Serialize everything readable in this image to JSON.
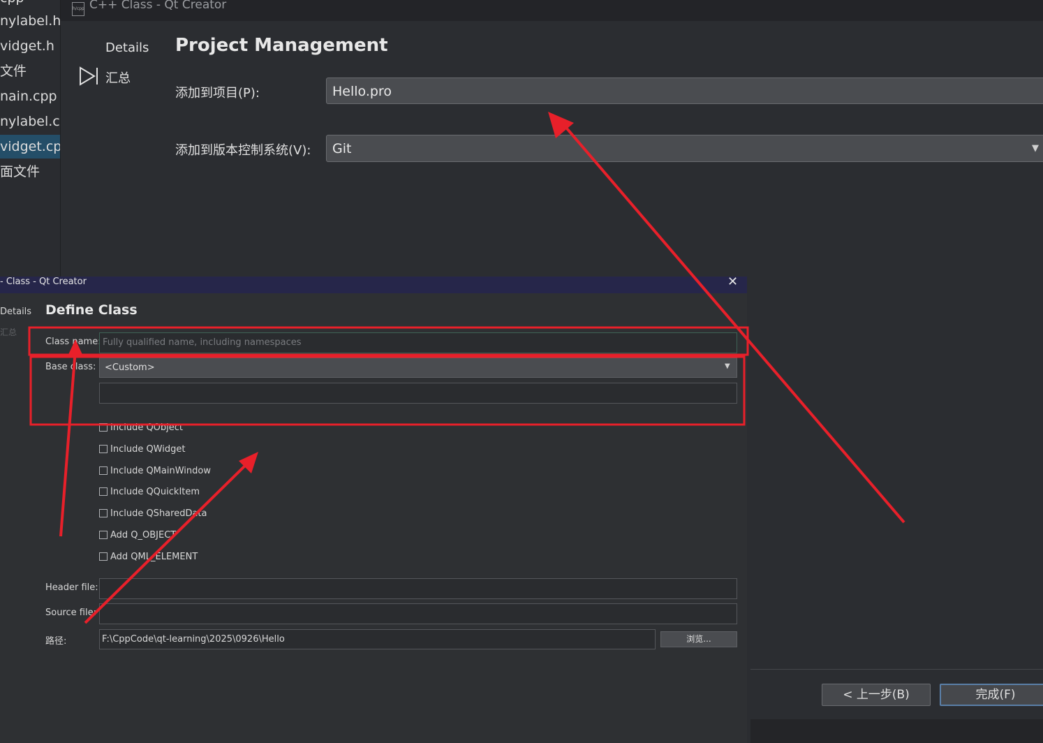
{
  "file_tree": {
    "items": [
      {
        "label": "nylabel.h"
      },
      {
        "label": "vidget.h"
      },
      {
        "label": "文件"
      },
      {
        "label": "nain.cpp"
      },
      {
        "label": "nylabel.cp"
      },
      {
        "label": "vidget.cpp",
        "selected": true
      },
      {
        "label": "面文件"
      }
    ]
  },
  "back_window": {
    "title": "C++ Class - Qt Creator",
    "icon_text": "h/cpp",
    "nav": {
      "details": "Details",
      "summary": "汇总"
    },
    "heading": "Project Management",
    "add_to_project_label": "添加到项目(P):",
    "add_to_project_value": "Hello.pro",
    "vcs_label": "添加到版本控制系统(V):",
    "vcs_value": "Git",
    "back_button": "< 上一步(B)",
    "finish_button": "完成(F)"
  },
  "front_dialog": {
    "title": "- Class - Qt Creator",
    "nav": {
      "details": "Details",
      "summary": "汇总"
    },
    "heading": "Define Class",
    "class_name_label": "Class name:",
    "class_name_placeholder": "Fully qualified name, including namespaces",
    "base_class_label": "Base class:",
    "base_class_value": "<Custom>",
    "checkboxes": [
      {
        "label": "Include QObject",
        "checked": false
      },
      {
        "label": "Include QWidget",
        "checked": false
      },
      {
        "label": "Include QMainWindow",
        "checked": false
      },
      {
        "label": "Include QQuickItem",
        "checked": false
      },
      {
        "label": "Include QSharedData",
        "checked": false
      },
      {
        "label": "Add Q_OBJECT",
        "checked": false
      },
      {
        "label": "Add QML_ELEMENT",
        "checked": false
      }
    ],
    "header_file_label": "Header file:",
    "source_file_label": "Source file:",
    "path_label": "路径:",
    "path_value": "F:\\CppCode\\qt-learning\\2025\\0926\\Hello",
    "browse_button": "浏览..."
  },
  "colors": {
    "annotation": "#e8202a",
    "selection": "#244e68",
    "dialog_titlebar": "#26264a"
  }
}
